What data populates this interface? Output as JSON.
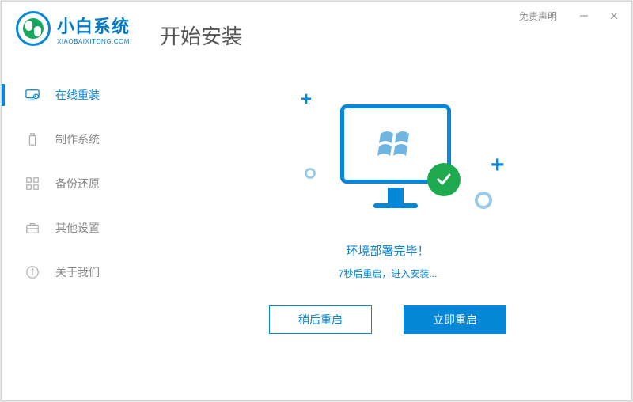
{
  "titlebar": {
    "disclaimer": "免责声明"
  },
  "brand": {
    "title": "小白系统",
    "subtitle": "XIAOBAIXITONG.COM"
  },
  "page_title": "开始安装",
  "sidebar": {
    "items": [
      {
        "label": "在线重装"
      },
      {
        "label": "制作系统"
      },
      {
        "label": "备份还原"
      },
      {
        "label": "其他设置"
      },
      {
        "label": "关于我们"
      }
    ]
  },
  "status": {
    "main": "环境部署完毕！",
    "sub": "7秒后重启，进入安装..."
  },
  "buttons": {
    "later": "稍后重启",
    "now": "立即重启"
  }
}
